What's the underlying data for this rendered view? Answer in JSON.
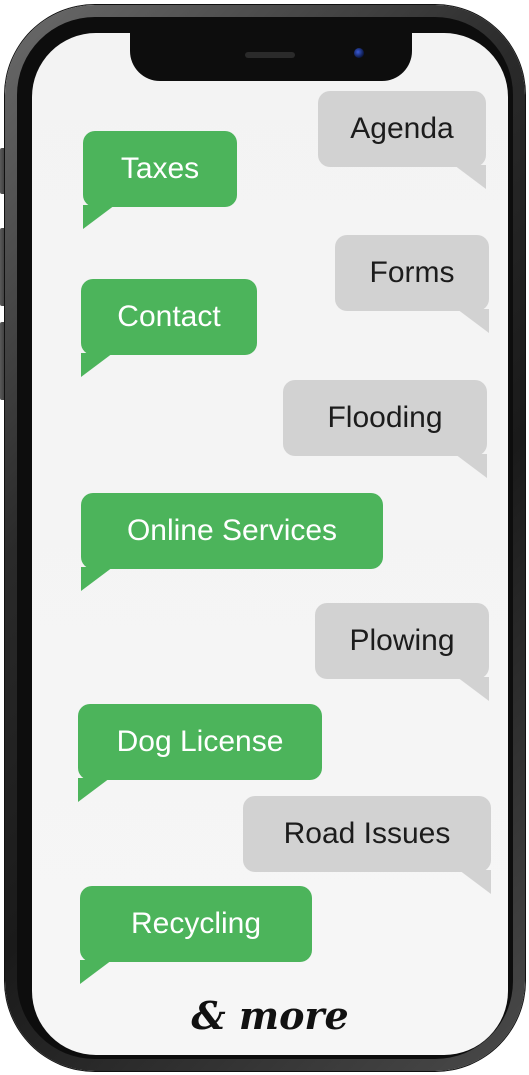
{
  "bubbles": {
    "agenda": "Agenda",
    "taxes": "Taxes",
    "forms": "Forms",
    "contact": "Contact",
    "flooding": "Flooding",
    "online_services": "Online Services",
    "plowing": "Plowing",
    "dog_license": "Dog License",
    "road_issues": "Road Issues",
    "recycling": "Recycling"
  },
  "footer": {
    "more_text": "& more"
  },
  "colors": {
    "green_bubble": "#4cb45b",
    "gray_bubble": "#d2d2d2",
    "phone_frame": "#1a1a1a",
    "screen_background": "#f3f3f3"
  }
}
